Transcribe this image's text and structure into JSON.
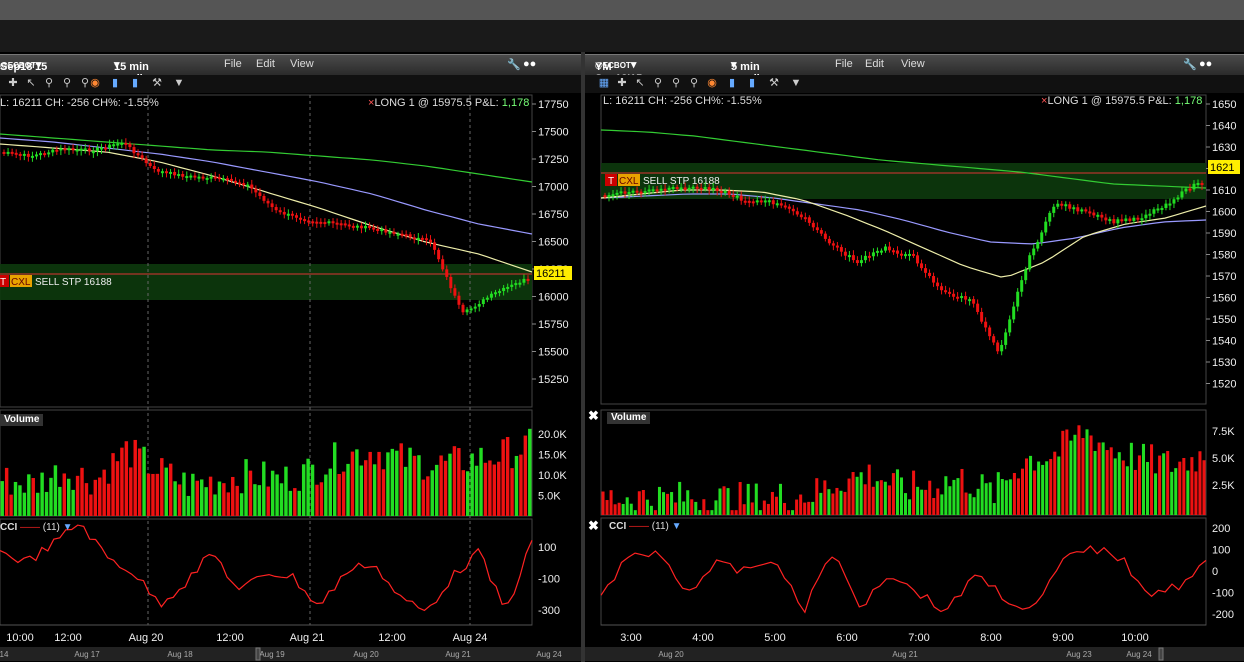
{
  "colors": {
    "up": "#22dd22",
    "down": "#ee1111",
    "ma_green": "#33cc33",
    "ma_blue": "#9999ff",
    "ma_yellow": "#eeeeaa",
    "cci": "#ff2222",
    "highlight": "#ffee00"
  },
  "left": {
    "title": "Sep18'15",
    "exchange": "@ECBOT",
    "interval": "15 min candles",
    "menus": [
      "File",
      "Edit",
      "View"
    ],
    "info": "L: 16211 CH: -256 CH%: -1.55%",
    "position": "LONG 1 @ 15975.5 P&L:",
    "pnl": "1,178",
    "order_tags": [
      "T",
      "CXL"
    ],
    "order_label": "SELL STP 16188",
    "last_price": "16211",
    "price_ticks": [
      "17750",
      "17500",
      "17250",
      "17000",
      "16750",
      "16500",
      "16250",
      "16000",
      "15750",
      "15500",
      "15250"
    ],
    "volume_label": "Volume",
    "volume_ticks": [
      "20.0K",
      "15.0K",
      "10.0K",
      "5.0K"
    ],
    "cci_label": "CCI",
    "cci_period": "(11)",
    "cci_ticks": [
      "100",
      "-100",
      "-300"
    ],
    "time_ticks": [
      "10:00",
      "12:00",
      "Aug 20",
      "12:00",
      "Aug 21",
      "12:00",
      "Aug 24"
    ],
    "date_ticks": [
      "14",
      "Aug 17",
      "Aug 18",
      "Aug 19",
      "Aug 20",
      "Aug 21",
      "Aug 24"
    ]
  },
  "right": {
    "title": "YM Sep18'15",
    "exchange": "@ECBOT",
    "interval": "5 min candles",
    "menus": [
      "File",
      "Edit",
      "View"
    ],
    "info": "L: 16211 CH: -256 CH%: -1.55%",
    "position": "LONG 1 @ 15975.5 P&L:",
    "pnl": "1,178",
    "order_tags": [
      "T",
      "CXL"
    ],
    "order_label": "SELL STP 16188",
    "last_price": "1621",
    "price_ticks": [
      "1650",
      "1640",
      "1630",
      "1620",
      "1610",
      "1600",
      "1590",
      "1580",
      "1570",
      "1560",
      "1550",
      "1540",
      "1530",
      "1520"
    ],
    "volume_label": "Volume",
    "volume_ticks": [
      "7.5K",
      "5.0K",
      "2.5K"
    ],
    "cci_label": "CCI",
    "cci_period": "(11)",
    "cci_ticks": [
      "200",
      "100",
      "0",
      "-100",
      "-200"
    ],
    "time_ticks": [
      "3:00",
      "4:00",
      "5:00",
      "6:00",
      "7:00",
      "8:00",
      "9:00",
      "10:00"
    ],
    "date_ticks": [
      "Aug 20",
      "Aug 21",
      "Aug 23",
      "Aug 24"
    ]
  }
}
